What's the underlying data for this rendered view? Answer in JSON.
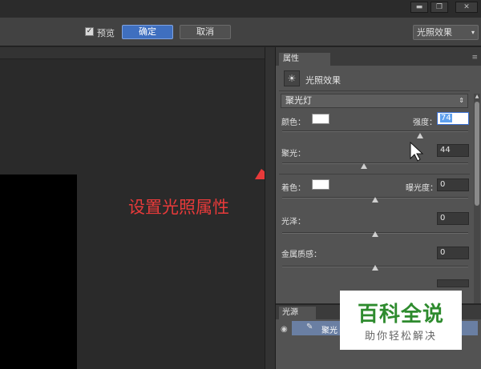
{
  "window_controls": {
    "minimize": "▬",
    "restore": "❐",
    "close": "✕"
  },
  "options_bar": {
    "preview_checkbox": {
      "label": "预览",
      "checked": true
    },
    "ok_label": "确定",
    "cancel_label": "取消",
    "preset": {
      "value": "光照效果",
      "arrow": "▾"
    }
  },
  "annotation": {
    "text": "设置光照属性",
    "color": "#e83a3a"
  },
  "properties_panel": {
    "tab_label": "属性",
    "menu_glyph": "≡",
    "effect_icon": "light-effect-icon",
    "effect_title": "光照效果",
    "light_type": {
      "value": "聚光灯",
      "arrow": "⇕"
    },
    "color_label": "颜色：",
    "intensity_label": "强度：",
    "intensity_value": "74",
    "intensity_slider": 0.74,
    "hotspot_label": "聚光：",
    "hotspot_value": "44",
    "hotspot_slider": 0.44,
    "colorize_label": "着色：",
    "exposure_label": "曝光度：",
    "exposure_value": "0",
    "exposure_slider": 0.5,
    "gloss_label": "光泽：",
    "gloss_value": "0",
    "gloss_slider": 0.5,
    "metallic_label": "金属质感：",
    "metallic_value": "0",
    "metallic_slider": 0.5
  },
  "lights_panel": {
    "tab_label": "光源",
    "eye_icon": "eye-icon",
    "light_item_icon": "spotlight-icon",
    "light_item_label": "聚光"
  },
  "watermark": {
    "main": "百科全说",
    "sub": "助你轻松解决"
  },
  "colors": {
    "accent": "#3f6fbf",
    "annotation": "#e83a3a",
    "watermark_green": "#2e8b2e"
  }
}
